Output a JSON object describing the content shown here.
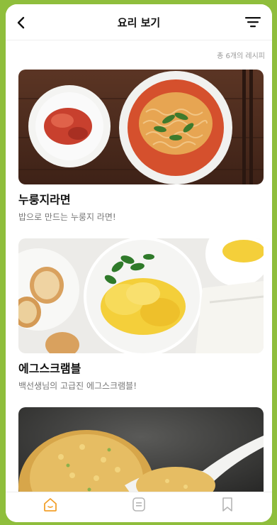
{
  "header": {
    "title": "요리 보기"
  },
  "recipe_count": "총 6개의 레시피",
  "recipes": [
    {
      "name": "누룽지라면",
      "desc": "밥으로 만드는 누룽지 라면!"
    },
    {
      "name": "에그스크램블",
      "desc": "백선생님의 고급진 에그스크램블!"
    },
    {
      "name": "",
      "desc": ""
    }
  ],
  "tabs": [
    {
      "label": "",
      "icon": "home-icon",
      "active": true
    },
    {
      "label": "",
      "icon": "recipe-list-icon",
      "active": false
    },
    {
      "label": "",
      "icon": "bookmark-icon",
      "active": false
    }
  ],
  "colors": {
    "background": "#8fbe3c",
    "accent": "#f2a02b"
  }
}
